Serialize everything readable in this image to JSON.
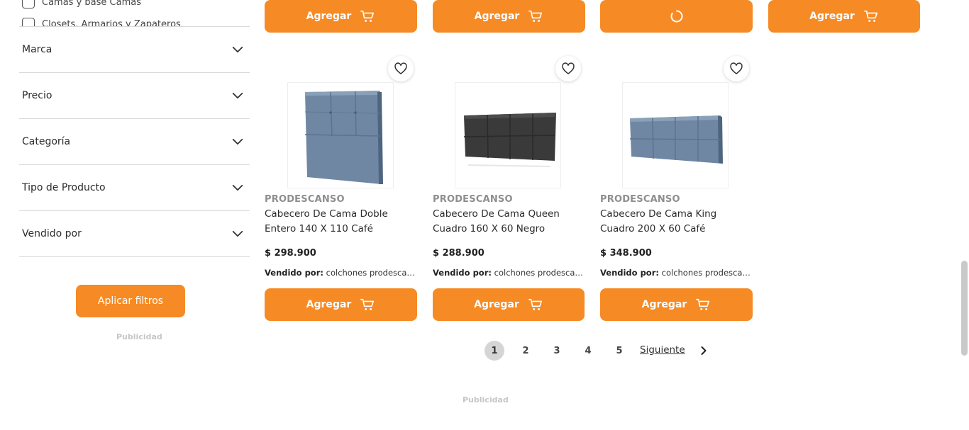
{
  "sidebar": {
    "category_options": [
      {
        "label": "Camas y base Camas"
      },
      {
        "label": "Closets, Armarios y Zapateros"
      }
    ],
    "filters": [
      {
        "label": "Marca"
      },
      {
        "label": "Precio"
      },
      {
        "label": "Categoría"
      },
      {
        "label": "Tipo de Producto"
      },
      {
        "label": "Vendido por"
      }
    ],
    "apply_label": "Aplicar filtros",
    "ad_label": "Publicidad"
  },
  "top_row": {
    "buttons": [
      {
        "label": "Agregar",
        "state": "idle"
      },
      {
        "label": "Agregar",
        "state": "idle"
      },
      {
        "label": "",
        "state": "loading"
      },
      {
        "label": "Agregar",
        "state": "idle"
      }
    ]
  },
  "products": [
    {
      "brand": "PRODESCANSO",
      "name": "Cabecero De Cama Doble Entero 140 X 110 Café",
      "price": "$ 298.900",
      "seller_label": "Vendido por:",
      "seller": "colchones prodescanso",
      "button_label": "Agregar",
      "image": "headboard-blue-tall"
    },
    {
      "brand": "PRODESCANSO",
      "name": "Cabecero De Cama Queen Cuadro 160 X 60 Negro",
      "price": "$ 288.900",
      "seller_label": "Vendido por:",
      "seller": "colchones prodescanso",
      "button_label": "Agregar",
      "image": "headboard-black-wide"
    },
    {
      "brand": "PRODESCANSO",
      "name": "Cabecero De Cama King Cuadro 200 X 60 Café",
      "price": "$ 348.900",
      "seller_label": "Vendido por:",
      "seller": "colchones prodescanso",
      "button_label": "Agregar",
      "image": "headboard-blue-wide"
    }
  ],
  "pagination": {
    "pages": [
      "1",
      "2",
      "3",
      "4",
      "5"
    ],
    "current": "1",
    "next_label": "Siguiente"
  },
  "footer": {
    "ad_label": "Publicidad"
  },
  "colors": {
    "accent": "#f68a24",
    "muted_text": "#8e8e8e",
    "active_page": "#d5d5d5"
  }
}
